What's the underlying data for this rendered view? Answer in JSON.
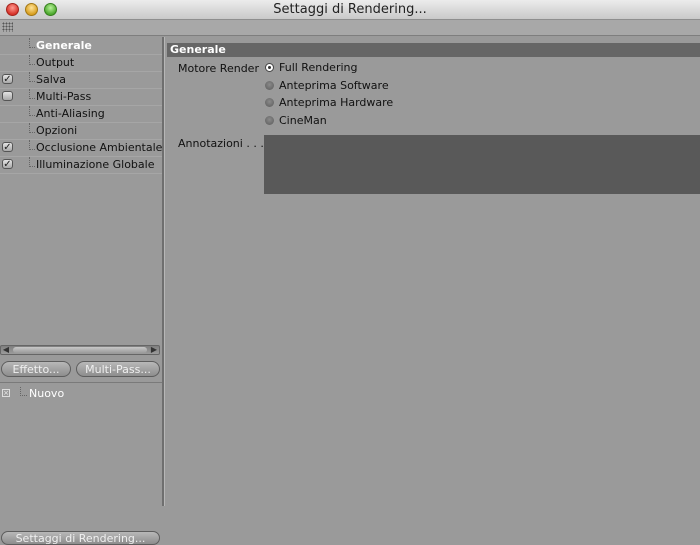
{
  "window": {
    "title": "Settaggi di Rendering..."
  },
  "tree": {
    "items": [
      {
        "label": "Generale",
        "checked": null
      },
      {
        "label": "Output",
        "checked": null
      },
      {
        "label": "Salva",
        "checked": true
      },
      {
        "label": "Multi-Pass",
        "checked": false
      },
      {
        "label": "Anti-Aliasing",
        "checked": null
      },
      {
        "label": "Opzioni",
        "checked": null
      },
      {
        "label": "Occlusione Ambientale",
        "checked": true
      },
      {
        "label": "Illuminazione Globale",
        "checked": true
      }
    ],
    "selected_index": 0
  },
  "buttons": {
    "effetto": "Effetto...",
    "multipass": "Multi-Pass...",
    "settaggi": "Settaggi di Rendering..."
  },
  "effects_list": {
    "items": [
      {
        "label": "Nuovo"
      }
    ]
  },
  "main": {
    "section_title": "Generale",
    "render_engine_label": "Motore Render",
    "render_engines": [
      {
        "label": "Full Rendering"
      },
      {
        "label": "Anteprima Software"
      },
      {
        "label": "Anteprima Hardware"
      },
      {
        "label": "CineMan"
      }
    ],
    "selected_engine_index": 0,
    "notes_label": "Annotazioni . . . .",
    "notes_value": ""
  },
  "icons": {
    "close": "close-icon",
    "minimize": "minimize-icon",
    "maximize": "maximize-icon",
    "grip": "grip-icon"
  }
}
